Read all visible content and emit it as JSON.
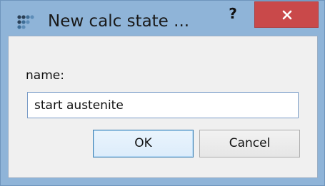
{
  "window": {
    "title": "New calc state ...",
    "help_label": "?",
    "app_icon": "matrix-dots-icon",
    "close_icon": "close-icon"
  },
  "form": {
    "name_label": "name:",
    "name_value": "start austenite"
  },
  "buttons": {
    "ok_label": "OK",
    "cancel_label": "Cancel"
  },
  "colors": {
    "frame": "#8fb4d8",
    "close_button": "#c9494a",
    "client": "#f0f0f0",
    "input_border": "#7a9cc7",
    "default_button_border": "#3c7fb1"
  }
}
